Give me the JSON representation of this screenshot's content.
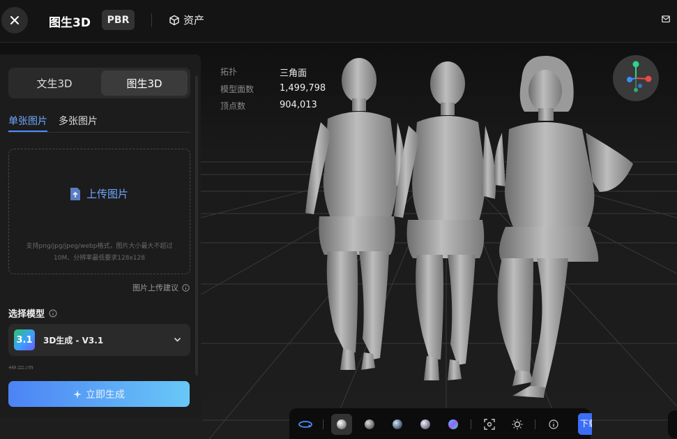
{
  "header": {
    "title": "图生3D",
    "badge": "PBR",
    "assets_label": "资产",
    "icons": [
      "close-icon",
      "cube-icon",
      "mail-icon"
    ]
  },
  "panel": {
    "mode_tabs": [
      {
        "label": "文生3D",
        "active": false
      },
      {
        "label": "图生3D",
        "active": true
      }
    ],
    "sub_tabs": [
      {
        "label": "单张图片",
        "active": true
      },
      {
        "label": "多张图片",
        "active": false
      }
    ],
    "upload": {
      "button_label": "上传图片",
      "hint_line1": "支持png/jpg/jpeg/webp格式，图片大小最大不超过",
      "hint_line2": "10M、分辨率最低要求128x128",
      "tip_label": "图片上传建议"
    },
    "model": {
      "section_label": "选择模型",
      "icon_text": "3.1",
      "selected": "3D生成 - V3.1"
    },
    "cut_text": "提示词",
    "generate_label": "立即生成"
  },
  "stats": [
    {
      "label": "拓扑",
      "value": "三角面"
    },
    {
      "label": "模型面数",
      "value": "1,499,798"
    },
    {
      "label": "顶点数",
      "value": "904,013"
    }
  ],
  "toolbar": {
    "items": [
      "rotate-icon",
      "material-clay-icon",
      "material-matte-icon",
      "material-metal-icon",
      "material-gloss-icon",
      "material-color-icon",
      "screenshot-icon",
      "lighting-icon",
      "info-icon"
    ],
    "download_label": "下载"
  },
  "colors": {
    "accent": "#4d8dff",
    "link": "#6fa8ff",
    "gizmo_x": "#e84a4a",
    "gizmo_y": "#2fd38c",
    "gizmo_z": "#3b8cff"
  }
}
